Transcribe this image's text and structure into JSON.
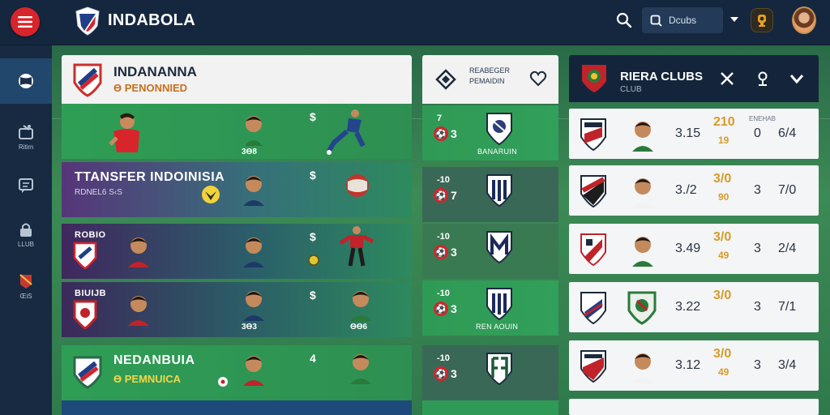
{
  "app": {
    "brand": "INDABOLA",
    "search_value": "Dcubs"
  },
  "rail": {
    "items": [
      "",
      "Ritim",
      "",
      "LLUB",
      "ŒiS"
    ]
  },
  "panel_a": {
    "title": "INDANANNA",
    "subtitle": "Ɵ PENONNIED",
    "rows": [
      {
        "line1": "",
        "line2": "",
        "sym": "$",
        "tag": "3Ɵ8"
      },
      {
        "line1": "TTANSFER INDOINISIA",
        "line2": "RDNEL6 S‹S",
        "sym": "$",
        "tag": ""
      },
      {
        "line1": "ROBIO",
        "line2": "",
        "sym": "$",
        "tag": ""
      },
      {
        "line1": "BIUIJB",
        "line2": "",
        "sym": "$",
        "tag": "3Ɵ3",
        "tag2": "ƟƟ6"
      },
      {
        "line1": "NEDANBUIA",
        "line2": "Ɵ PEMNUICA",
        "sym": "4",
        "tag": ""
      }
    ]
  },
  "panel_b": {
    "title": "REABEGER PEMAIDIN",
    "rows": [
      {
        "time": "7",
        "score": "3",
        "venue": "BANARUIN"
      },
      {
        "time": "-10",
        "score": "7",
        "venue": ""
      },
      {
        "time": "-10",
        "score": "3",
        "venue": ""
      },
      {
        "time": "-10",
        "score": "3",
        "venue": "REN AOUIN"
      },
      {
        "time": "-10",
        "score": "3",
        "venue": ""
      }
    ]
  },
  "panel_c": {
    "title": "RIERA CLUBS",
    "subtitle": "CLUB",
    "rows": [
      {
        "v1": "3.15",
        "v2": "210",
        "v3": "19",
        "v4": "0",
        "v5": "6/4",
        "label": "ENEHAB"
      },
      {
        "v1": "3./2",
        "v2": "3/0",
        "v3": "90",
        "v4": "3",
        "v5": "7/0",
        "label": ""
      },
      {
        "v1": "3.49",
        "v2": "3/0",
        "v3": "49",
        "v4": "3",
        "v5": "2/4",
        "label": ""
      },
      {
        "v1": "3.22",
        "v2": "3/0",
        "v3": "",
        "v4": "3",
        "v5": "7/1",
        "label": ""
      },
      {
        "v1": "3.12",
        "v2": "3/0",
        "v3": "49",
        "v4": "3",
        "v5": "3/4",
        "label": ""
      }
    ]
  },
  "colors": {
    "accent": "#d8252b",
    "gold": "#d89a27",
    "green": "#2f8a52",
    "navy": "#15273f"
  }
}
